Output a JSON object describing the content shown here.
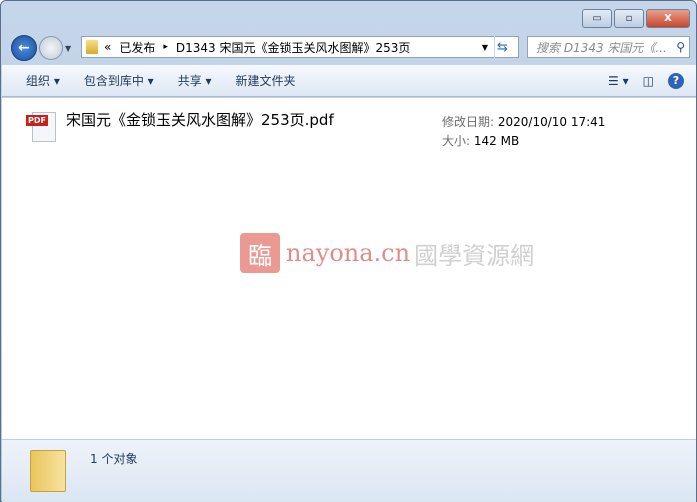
{
  "window": {
    "controls": {
      "minimize": "▭",
      "maximize": "▫",
      "close": "X"
    }
  },
  "address": {
    "overflow": "«",
    "crumbs": [
      "已发布",
      "D1343 宋国元《金锁玉关风水图解》253页"
    ],
    "separator": "▸"
  },
  "search": {
    "placeholder": "搜索 D1343 宋国元《..."
  },
  "toolbar": {
    "organize": "组织 ▾",
    "include_library": "包含到库中 ▾",
    "share": "共享 ▾",
    "new_folder": "新建文件夹",
    "help": "?"
  },
  "files": [
    {
      "name": "宋国元《金锁玉关风水图解》253页.pdf",
      "type_badge": "PDF",
      "modified_label": "修改日期:",
      "modified": "2020/10/10 17:41",
      "size_label": "大小:",
      "size": "142 MB"
    }
  ],
  "watermark": {
    "logo": "臨",
    "text": "nayona.cn",
    "text2": "國學資源網"
  },
  "status": {
    "count": "1 个对象"
  }
}
